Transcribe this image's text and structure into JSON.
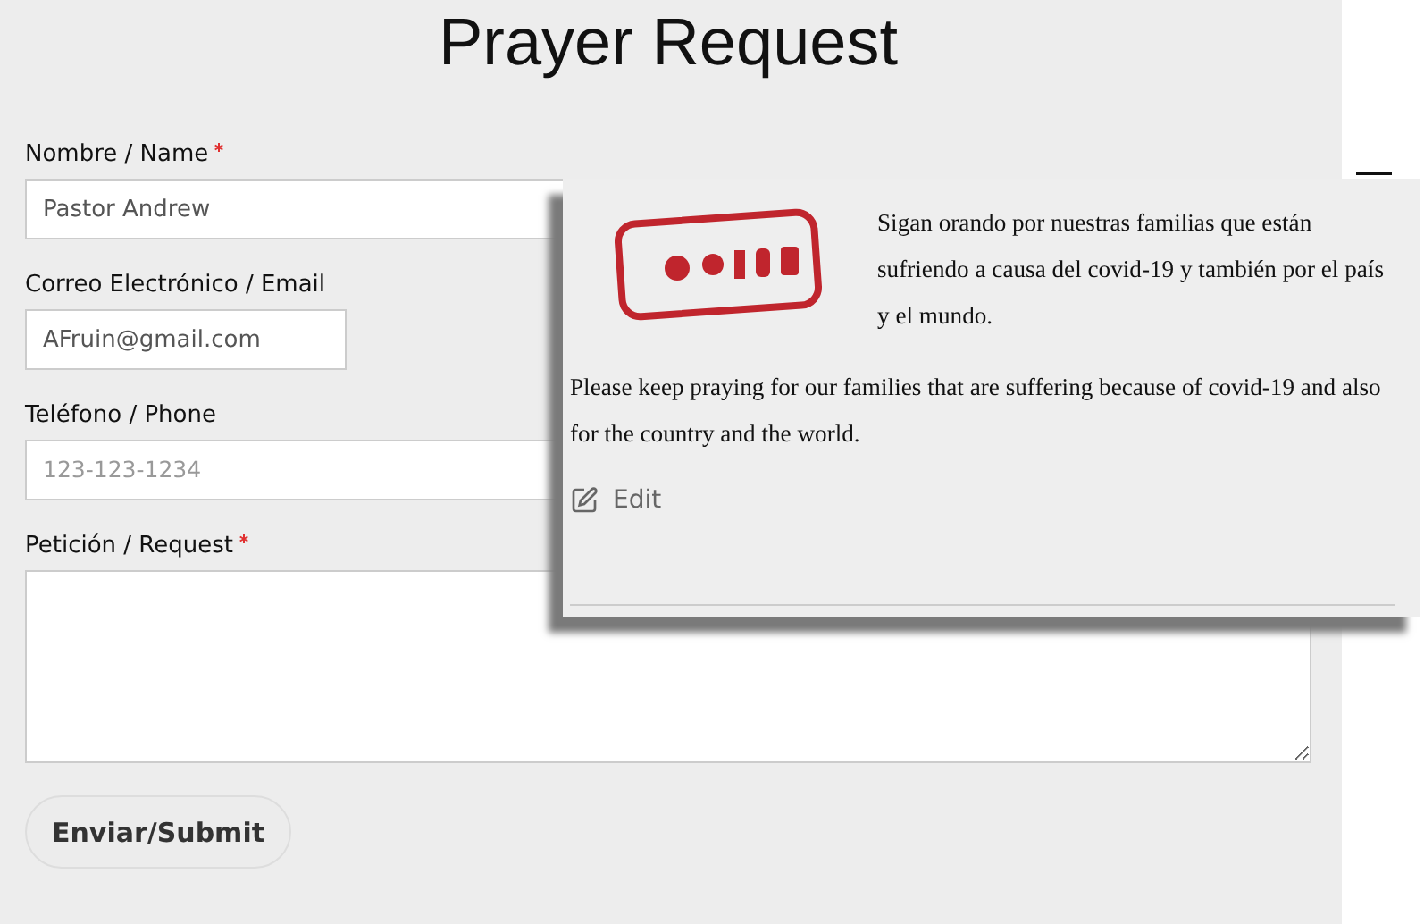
{
  "title": "Prayer Request",
  "fields": [
    {
      "kind": "input",
      "label": "Nombre / Name",
      "required": true,
      "value": "Pastor Andrew"
    },
    {
      "kind": "short-input",
      "label": "Correo Electrónico / Email",
      "required": false,
      "value": "AFruin@gmail.com"
    },
    {
      "kind": "input",
      "label": "Teléfono / Phone",
      "required": false,
      "placeholder": "123-123-1234"
    },
    {
      "kind": "textarea",
      "label": "Petición / Request",
      "required": true
    }
  ],
  "submit": "Enviar/Submit",
  "popup": {
    "spanish": "Sigan orando por nuestras familias que están sufriendo a causa del covid-19 y también por el país y el mundo.",
    "english": "Please keep praying for our families that are suffering because of covid-19 and also for the country and the world.",
    "edit": "Edit"
  }
}
